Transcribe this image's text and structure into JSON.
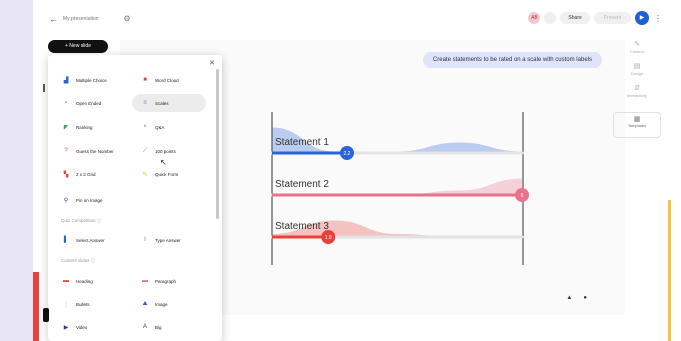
{
  "colors": {
    "accent": "#1f5fd6",
    "statement1": "#2b63d9",
    "statement2": "#e9738a",
    "statement3": "#e8413a",
    "chip_bg": "#dfe3fb"
  },
  "topbar": {
    "title": "My presentation",
    "share_label": "Share",
    "present_label": "Present",
    "avatar_text": "AB"
  },
  "new_slide_label": "+ New slide",
  "question_types": {
    "items": [
      {
        "label": "Multiple Choice",
        "icon": "bar-chart-icon"
      },
      {
        "label": "Word Cloud",
        "icon": "word-cloud-icon"
      },
      {
        "label": "Open Ended",
        "icon": "open-ended-icon"
      },
      {
        "label": "Scales",
        "icon": "scales-icon"
      },
      {
        "label": "Ranking",
        "icon": "ranking-icon"
      },
      {
        "label": "Q&A",
        "icon": "qa-icon"
      },
      {
        "label": "Guess the Number",
        "icon": "question-mark-icon"
      },
      {
        "label": "100 points",
        "icon": "points-icon"
      },
      {
        "label": "2 x 2 Grid",
        "icon": "grid-icon"
      },
      {
        "label": "Quick Form",
        "icon": "quick-form-icon"
      },
      {
        "label": "Pin on Image",
        "icon": "pin-icon"
      }
    ]
  },
  "quiz_section": {
    "heading": "Quiz Competition",
    "items": [
      {
        "label": "Select Answer",
        "icon": "select-answer-icon"
      },
      {
        "label": "Type Answer",
        "icon": "type-answer-icon"
      }
    ]
  },
  "content_section": {
    "heading": "Content slides",
    "items": [
      {
        "label": "Heading",
        "icon": "heading-icon"
      },
      {
        "label": "Paragraph",
        "icon": "paragraph-icon"
      },
      {
        "label": "Bullets",
        "icon": "bullets-icon"
      },
      {
        "label": "Image",
        "icon": "image-icon"
      },
      {
        "label": "Video",
        "icon": "video-icon"
      },
      {
        "label": "Big",
        "icon": "big-text-icon"
      }
    ]
  },
  "slide": {
    "chip_text": "Create statements to be rated on a scale with custom labels"
  },
  "chart_data": {
    "type": "scale",
    "title": "",
    "xlim": [
      1,
      5
    ],
    "series": [
      {
        "name": "Statement 1",
        "value": 2.2,
        "value_label": "2.2",
        "distribution": [
          0.85,
          0.05,
          0.05,
          0.35,
          0.05
        ]
      },
      {
        "name": "Statement 2",
        "value": 5,
        "value_label": "5",
        "distribution": [
          0,
          0,
          0,
          0.15,
          0.55
        ]
      },
      {
        "name": "Statement 3",
        "value": 1.9,
        "value_label": "1.9",
        "distribution": [
          0.1,
          0.55,
          0.1,
          0,
          0
        ]
      }
    ]
  },
  "right_rail": {
    "items": [
      {
        "label": "Content",
        "icon": "pencil-icon"
      },
      {
        "label": "Design",
        "icon": "design-icon"
      },
      {
        "label": "Interactivity",
        "icon": "interactivity-icon"
      }
    ],
    "templates_label": "Templates"
  }
}
